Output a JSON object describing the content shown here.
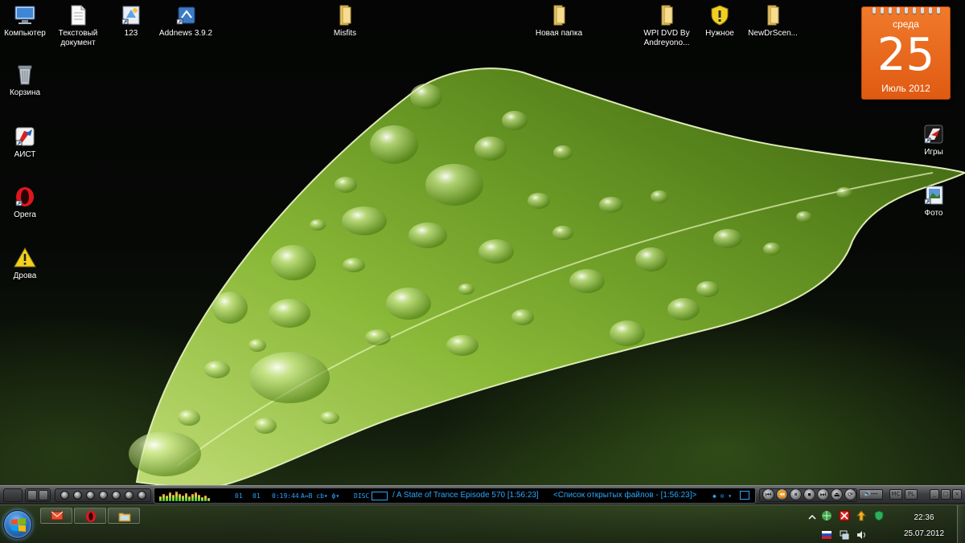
{
  "desktop": {
    "icons": [
      {
        "label": "Компьютер",
        "icon": "computer-icon"
      },
      {
        "label": "Текстовый документ",
        "icon": "text-document-icon"
      },
      {
        "label": "123",
        "icon": "shortcut-icon"
      },
      {
        "label": "Addnews 3.9.2",
        "icon": "installer-icon"
      },
      {
        "label": "Misfits",
        "icon": "folder-icon"
      },
      {
        "label": "Новая папка",
        "icon": "folder-icon"
      },
      {
        "label": "WPI DVD By Andreyono...",
        "icon": "folder-icon"
      },
      {
        "label": "Нужное",
        "icon": "shield-icon"
      },
      {
        "label": "NewDrScen...",
        "icon": "folder-icon"
      },
      {
        "label": "Корзина",
        "icon": "recycle-bin-icon"
      },
      {
        "label": "АИСТ",
        "icon": "aist-icon"
      },
      {
        "label": "Opera",
        "icon": "opera-icon"
      },
      {
        "label": "Дрова",
        "icon": "warning-icon"
      },
      {
        "label": "Игры",
        "icon": "games-icon"
      },
      {
        "label": "Фото",
        "icon": "photo-icon"
      }
    ]
  },
  "calendar": {
    "weekday": "среда",
    "day": "25",
    "month_year": "Июль 2012",
    "color": "#e8651c"
  },
  "player": {
    "track_num": "01",
    "track_num2": "01",
    "time": "0:19:44",
    "modes": "A↔B  cb▾  ф▾",
    "disc": "DISC",
    "now_playing": "/ A State of Trance Episode 570  [1:56:23]",
    "playlist": "<Список открытых файлов - [1:56:23]>",
    "accent": "#2aa9ff"
  },
  "taskbar": {
    "items": [
      {
        "name": "mail",
        "icon": "mail-icon"
      },
      {
        "name": "opera",
        "icon": "opera-icon"
      },
      {
        "name": "explorer",
        "icon": "folder-icon"
      }
    ],
    "clock_time": "22:36",
    "clock_date": "25.07.2012"
  }
}
